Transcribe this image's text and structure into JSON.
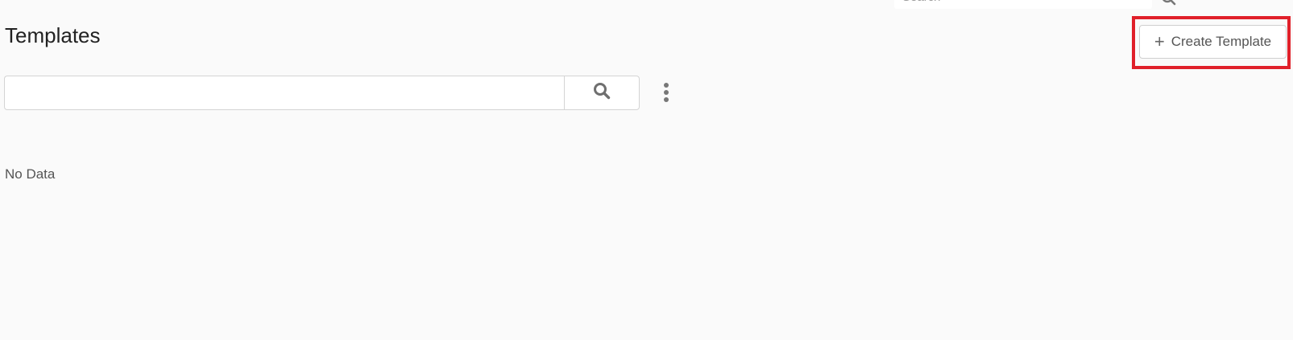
{
  "header": {
    "search_placeholder": "Search",
    "icons": [
      "search-icon",
      "question-icon",
      "bell-icon",
      "user-chevron-icon"
    ]
  },
  "page": {
    "title": "Templates",
    "create_button_label": "Create Template",
    "create_button_icon": "plus-icon",
    "highlight_color": "#e0202a"
  },
  "filter": {
    "search_value": "",
    "search_button_icon": "search-icon",
    "more_icon": "kebab-menu-icon"
  },
  "content": {
    "empty_text": "No Data"
  }
}
